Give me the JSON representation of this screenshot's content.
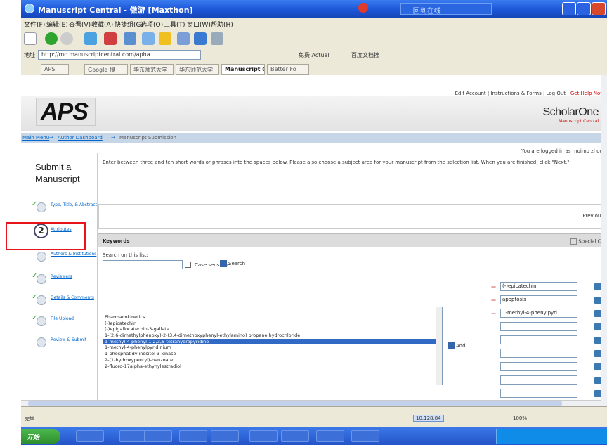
{
  "window": {
    "title": "Manuscript Central - 傲游 [Maxthon]",
    "tray_text": "... 回到在线"
  },
  "menu": [
    "文件(F)",
    "编辑(E)",
    "查看(V)",
    "收藏(A)",
    "快捷组(G)",
    "选项(O)",
    "工具(T)",
    "窗口(W)",
    "帮助(H)"
  ],
  "address": {
    "label": "地址",
    "url": "http://mc.manuscriptcentral.com/apha",
    "ext_left": "免费 Actual",
    "ext_right": "百度文档搜"
  },
  "tabs": [
    "APS",
    "Google 搜",
    "华东师范大学",
    "华东师范大学",
    "Manuscript C",
    "Better Fo"
  ],
  "top_links": {
    "edit_account": "Edit Account",
    "instructions": "Instructions & Forms",
    "logout": "Log Out",
    "help": "Get Help Now",
    "sep": "|"
  },
  "logo": {
    "aps": "APS",
    "s1_main": "ScholarOne",
    "s1_sub": "Manuscript Central"
  },
  "breadcrumb": {
    "main_menu": "Main Menu",
    "arrow": "→",
    "author_dashboard": "Author Dashboard",
    "submission": "Manuscript Submission"
  },
  "logged_in": "You are logged in as moimo zhou",
  "page_title": "Submit a Manuscript",
  "instructions": "Enter between three and ten short words or phrases into the spaces below. Please also choose a subject area for your manuscript from the selection list. When you are finished, click \"Next.\"",
  "steps": [
    {
      "label": "Type, Title, & Abstract",
      "done": true,
      "current": false,
      "num": ""
    },
    {
      "label": "Attributes",
      "done": false,
      "current": true,
      "num": "2"
    },
    {
      "label": "Authors & Institutions",
      "done": false,
      "current": false,
      "num": ""
    },
    {
      "label": "Reviewers",
      "done": true,
      "current": false,
      "num": ""
    },
    {
      "label": "Details & Comments",
      "done": true,
      "current": false,
      "num": ""
    },
    {
      "label": "File Upload",
      "done": true,
      "current": false,
      "num": ""
    },
    {
      "label": "Review & Submit",
      "done": false,
      "current": false,
      "num": ""
    }
  ],
  "nav": {
    "previous": "Previous"
  },
  "keywords": {
    "heading": "Keywords",
    "special_chars": "Special Ch",
    "search_label": "Search on this list:",
    "case_sensitive": "Case sensitive",
    "search_btn": "Search",
    "add_btn": "Add",
    "list": [
      "Pharmacokinetics",
      "(-)epicatechin",
      "(-)epigallocatechin-3-gallate",
      "1-(2,6-dimethylphenoxy)-2-(3,4-dimethoxyphenyl-ethylamino) propane hydrochloride",
      "1-methyl-4-phenyl-1,2,3,6-tetrahydropyridine",
      "1-methyl-4-phenylpyridinium",
      "1-phosphatidylinositol 3-kinase",
      "2-(1-hydroxypentyl)-benzoate",
      "2-fluoro-17alpha-ethynylestradiol"
    ],
    "selected_index": 4,
    "chosen": [
      "(-)epicatechin",
      "apoptosis",
      "1-methyl-4-phenylpyri",
      "",
      "",
      "",
      "",
      "",
      "",
      ""
    ],
    "dash": "—"
  },
  "status": {
    "text": "完毕",
    "ip": "10.128.84",
    "zoom": "100%"
  },
  "taskbar": {
    "start": "开始",
    "tasks": [
      "",
      "",
      "",
      "",
      "",
      "",
      "",
      "",
      ""
    ]
  }
}
